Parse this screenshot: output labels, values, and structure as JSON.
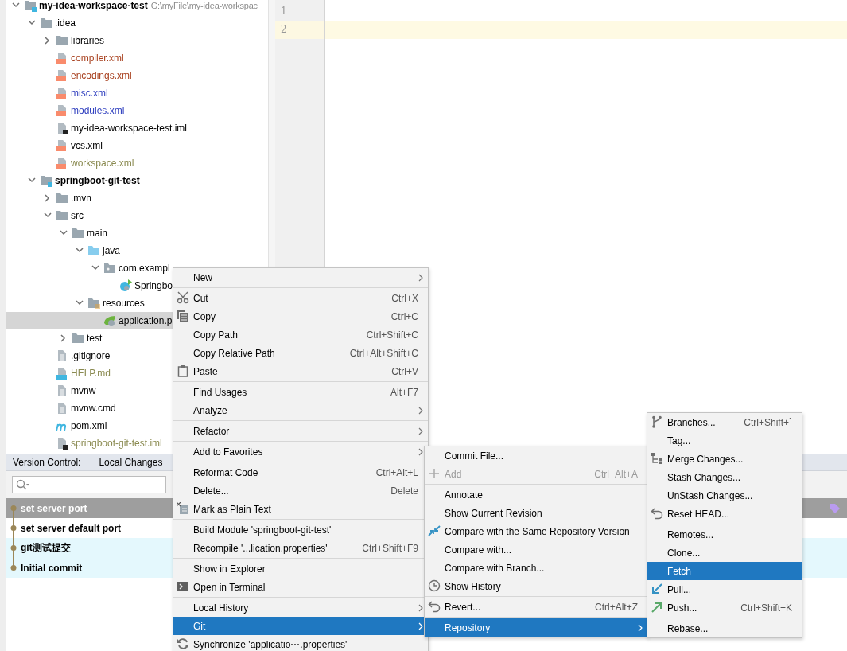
{
  "project_tree": {
    "items": [
      {
        "label": "my-idea-workspace-test",
        "path": "G:\\myFile\\my-idea-workspac",
        "kind": "module",
        "expanded": true,
        "selected": false,
        "children": [
          {
            "label": ".idea",
            "kind": "folder",
            "expanded": true,
            "selected": false,
            "children": [
              {
                "label": "libraries",
                "kind": "folder",
                "expanded": false,
                "selected": false
              },
              {
                "label": "compiler.xml",
                "kind": "xml",
                "color": "#a8401e",
                "selected": false
              },
              {
                "label": "encodings.xml",
                "kind": "xml",
                "color": "#a8401e",
                "selected": false
              },
              {
                "label": "misc.xml",
                "kind": "xml",
                "color": "#2f3fbf",
                "selected": false
              },
              {
                "label": "modules.xml",
                "kind": "xml",
                "color": "#2f3fbf",
                "selected": false
              },
              {
                "label": "my-idea-workspace-test.iml",
                "kind": "iml",
                "selected": false
              },
              {
                "label": "vcs.xml",
                "kind": "xml",
                "selected": false
              },
              {
                "label": "workspace.xml",
                "kind": "xml",
                "color": "#8a8a50",
                "selected": false
              }
            ]
          },
          {
            "label": "springboot-git-test",
            "kind": "module",
            "expanded": true,
            "selected": false,
            "children": [
              {
                "label": ".mvn",
                "kind": "folder",
                "expanded": false,
                "selected": false
              },
              {
                "label": "src",
                "kind": "folder",
                "expanded": true,
                "selected": false,
                "children": [
                  {
                    "label": "main",
                    "kind": "folder",
                    "expanded": true,
                    "selected": false,
                    "children": [
                      {
                        "label": "java",
                        "kind": "source-folder",
                        "expanded": true,
                        "selected": false,
                        "children": [
                          {
                            "label": "com.exampl",
                            "kind": "package",
                            "expanded": true,
                            "selected": false,
                            "children": [
                              {
                                "label": "Springbo",
                                "kind": "class",
                                "selected": false
                              }
                            ]
                          }
                        ]
                      },
                      {
                        "label": "resources",
                        "kind": "resource-folder",
                        "expanded": true,
                        "selected": false,
                        "children": [
                          {
                            "label": "application.p",
                            "kind": "properties",
                            "selected": true
                          }
                        ]
                      }
                    ]
                  },
                  {
                    "label": "test",
                    "kind": "folder",
                    "expanded": false,
                    "selected": false
                  }
                ]
              },
              {
                "label": ".gitignore",
                "kind": "text",
                "selected": false
              },
              {
                "label": "HELP.md",
                "kind": "markdown",
                "color": "#8a8a50",
                "selected": false
              },
              {
                "label": "mvnw",
                "kind": "text",
                "selected": false
              },
              {
                "label": "mvnw.cmd",
                "kind": "text",
                "selected": false
              },
              {
                "label": "pom.xml",
                "kind": "maven",
                "selected": false
              },
              {
                "label": "springboot-git-test.iml",
                "kind": "iml",
                "color": "#8a8a50",
                "selected": false
              }
            ]
          }
        ]
      }
    ]
  },
  "editor": {
    "lines": [
      {
        "number": "1",
        "current": false
      },
      {
        "number": "2",
        "current": true
      }
    ]
  },
  "version_control": {
    "title": "Version Control:",
    "tabs": [
      {
        "label": "Local Changes",
        "selected": false
      }
    ],
    "commits": [
      {
        "message": "set server port",
        "selected": true,
        "highlighted": false,
        "tagged": true
      },
      {
        "message": "set server default port",
        "selected": false,
        "highlighted": false,
        "tagged": false
      },
      {
        "message": "git测试提交",
        "selected": false,
        "highlighted": true,
        "tagged": false
      },
      {
        "message": "Initial commit",
        "selected": false,
        "highlighted": true,
        "tagged": false
      }
    ]
  },
  "context_menu": {
    "items": [
      {
        "kind": "submenu",
        "label": "New",
        "selected": false,
        "disabled": false
      },
      {
        "kind": "separator"
      },
      {
        "kind": "action",
        "label": "Cut",
        "shortcut": "Ctrl+X",
        "selected": false,
        "disabled": false
      },
      {
        "kind": "action",
        "label": "Copy",
        "shortcut": "Ctrl+C",
        "selected": false,
        "disabled": false
      },
      {
        "kind": "action",
        "label": "Copy Path",
        "shortcut": "Ctrl+Shift+C",
        "selected": false,
        "disabled": false
      },
      {
        "kind": "action",
        "label": "Copy Relative Path",
        "shortcut": "Ctrl+Alt+Shift+C",
        "selected": false,
        "disabled": false
      },
      {
        "kind": "action",
        "label": "Paste",
        "shortcut": "Ctrl+V",
        "selected": false,
        "disabled": false
      },
      {
        "kind": "separator"
      },
      {
        "kind": "action",
        "label": "Find Usages",
        "shortcut": "Alt+F7",
        "selected": false,
        "disabled": false
      },
      {
        "kind": "submenu",
        "label": "Analyze",
        "selected": false,
        "disabled": false
      },
      {
        "kind": "separator"
      },
      {
        "kind": "submenu",
        "label": "Refactor",
        "selected": false,
        "disabled": false
      },
      {
        "kind": "separator"
      },
      {
        "kind": "submenu",
        "label": "Add to Favorites",
        "selected": false,
        "disabled": false
      },
      {
        "kind": "separator"
      },
      {
        "kind": "action",
        "label": "Reformat Code",
        "shortcut": "Ctrl+Alt+L",
        "selected": false,
        "disabled": false
      },
      {
        "kind": "action",
        "label": "Delete...",
        "shortcut": "Delete",
        "selected": false,
        "disabled": false
      },
      {
        "kind": "action",
        "label": "Mark as Plain Text",
        "selected": false,
        "disabled": false
      },
      {
        "kind": "separator"
      },
      {
        "kind": "action",
        "label": "Build Module 'springboot-git-test'",
        "selected": false,
        "disabled": false
      },
      {
        "kind": "action",
        "label": "Recompile '...lication.properties'",
        "shortcut": "Ctrl+Shift+F9",
        "selected": false,
        "disabled": false
      },
      {
        "kind": "separator"
      },
      {
        "kind": "action",
        "label": "Show in Explorer",
        "selected": false,
        "disabled": false
      },
      {
        "kind": "action",
        "label": "Open in Terminal",
        "selected": false,
        "disabled": false
      },
      {
        "kind": "separator"
      },
      {
        "kind": "submenu",
        "label": "Local History",
        "selected": false,
        "disabled": false
      },
      {
        "kind": "submenu",
        "label": "Git",
        "selected": true,
        "disabled": false
      },
      {
        "kind": "action",
        "label": "Synchronize 'applicatio⋯.properties'",
        "selected": false,
        "disabled": false
      }
    ]
  },
  "git_menu": {
    "items": [
      {
        "kind": "action",
        "label": "Commit File...",
        "selected": false,
        "disabled": false
      },
      {
        "kind": "action",
        "label": "Add",
        "shortcut": "Ctrl+Alt+A",
        "selected": false,
        "disabled": true
      },
      {
        "kind": "separator"
      },
      {
        "kind": "action",
        "label": "Annotate",
        "selected": false,
        "disabled": false
      },
      {
        "kind": "action",
        "label": "Show Current Revision",
        "selected": false,
        "disabled": false
      },
      {
        "kind": "action",
        "label": "Compare with the Same Repository Version",
        "selected": false,
        "disabled": false
      },
      {
        "kind": "action",
        "label": "Compare with...",
        "selected": false,
        "disabled": false
      },
      {
        "kind": "action",
        "label": "Compare with Branch...",
        "selected": false,
        "disabled": false
      },
      {
        "kind": "action",
        "label": "Show History",
        "selected": false,
        "disabled": false
      },
      {
        "kind": "separator"
      },
      {
        "kind": "action",
        "label": "Revert...",
        "shortcut": "Ctrl+Alt+Z",
        "selected": false,
        "disabled": false
      },
      {
        "kind": "separator"
      },
      {
        "kind": "submenu",
        "label": "Repository",
        "selected": true,
        "disabled": false
      }
    ]
  },
  "repository_menu": {
    "items": [
      {
        "kind": "action",
        "label": "Branches...",
        "shortcut": "Ctrl+Shift+`",
        "selected": false,
        "disabled": false
      },
      {
        "kind": "action",
        "label": "Tag...",
        "selected": false,
        "disabled": false
      },
      {
        "kind": "action",
        "label": "Merge Changes...",
        "selected": false,
        "disabled": false
      },
      {
        "kind": "action",
        "label": "Stash Changes...",
        "selected": false,
        "disabled": false
      },
      {
        "kind": "action",
        "label": "UnStash Changes...",
        "selected": false,
        "disabled": false
      },
      {
        "kind": "action",
        "label": "Reset HEAD...",
        "selected": false,
        "disabled": false
      },
      {
        "kind": "separator"
      },
      {
        "kind": "action",
        "label": "Remotes...",
        "selected": false,
        "disabled": false
      },
      {
        "kind": "action",
        "label": "Clone...",
        "selected": false,
        "disabled": false
      },
      {
        "kind": "action",
        "label": "Fetch",
        "selected": true,
        "disabled": false
      },
      {
        "kind": "action",
        "label": "Pull...",
        "selected": false,
        "disabled": false
      },
      {
        "kind": "action",
        "label": "Push...",
        "shortcut": "Ctrl+Shift+K",
        "selected": false,
        "disabled": false
      },
      {
        "kind": "separator"
      },
      {
        "kind": "action",
        "label": "Rebase...",
        "selected": false,
        "disabled": false
      }
    ]
  }
}
